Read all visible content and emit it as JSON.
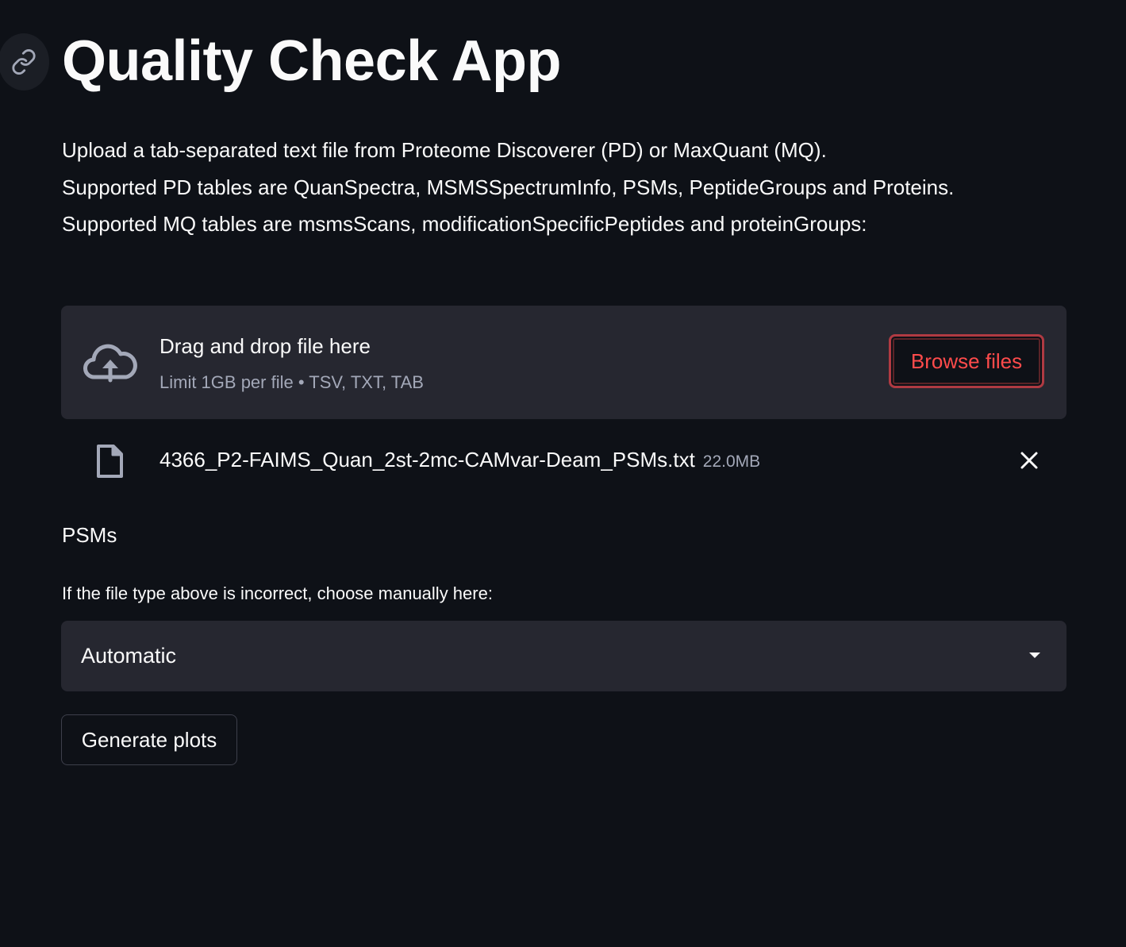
{
  "title": "Quality Check App",
  "description": {
    "line1": "Upload a tab-separated text file from Proteome Discoverer (PD) or MaxQuant (MQ).",
    "line2": "Supported PD tables are QuanSpectra, MSMSSpectrumInfo, PSMs, PeptideGroups and Proteins.",
    "line3": "Supported MQ tables are msmsScans, modificationSpecificPeptides and proteinGroups:"
  },
  "uploader": {
    "drop_label": "Drag and drop file here",
    "limit_label": "Limit 1GB per file • TSV, TXT, TAB",
    "browse_label": "Browse files",
    "icons": {
      "upload": "cloud-upload-icon",
      "file": "file-icon",
      "remove": "close-icon"
    }
  },
  "uploaded_file": {
    "name": "4366_P2-FAIMS_Quan_2st-2mc-CAMvar-Deam_PSMs.txt",
    "size": "22.0MB"
  },
  "detected_type": "PSMs",
  "file_type_select": {
    "label": "If the file type above is incorrect, choose manually here:",
    "selected": "Automatic"
  },
  "generate_button": "Generate plots",
  "colors": {
    "background": "#0e1117",
    "panel": "#262730",
    "accent": "#ff4b4b",
    "text": "#fafafa",
    "muted": "#a3a8b8"
  }
}
